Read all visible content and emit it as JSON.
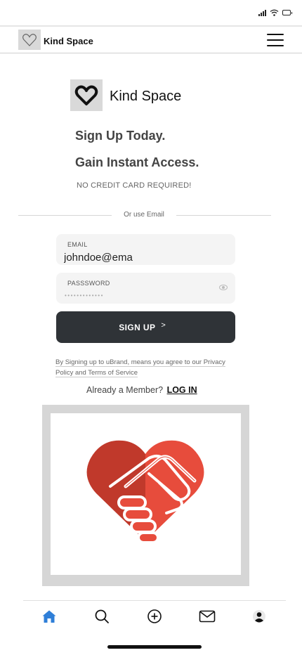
{
  "status_bar": {
    "signal_icon": "signal-icon",
    "wifi_icon": "wifi-icon",
    "battery_icon": "battery-icon"
  },
  "header": {
    "logo_icon": "heart-outline-icon",
    "title": "Kind Space",
    "menu_icon": "hamburger-menu-icon"
  },
  "brand": {
    "logo_icon": "heart-icon",
    "name": "Kind Space"
  },
  "hero": {
    "headline_1": "Sign Up Today.",
    "headline_2": "Gain Instant Access.",
    "subtext": "NO CREDIT CARD REQUIRED!"
  },
  "divider_text": "Or use Email",
  "form": {
    "email_label": "EMAIL",
    "email_value": "johndoe@ema",
    "password_label": "PASSSWORD",
    "password_dots": "•••••••••••••",
    "signup_label": "SIGN UP",
    "signup_chevron": ">"
  },
  "terms": {
    "text": "By Signing up to uBrand, means you agree to our Privacy Policy and Terms of Service"
  },
  "member": {
    "prompt": "Already a Member?",
    "login_label": "LOG IN"
  },
  "illustration": {
    "icon": "heart-handshake-icon"
  },
  "bottom_nav": {
    "items": [
      "home-icon",
      "search-icon",
      "add-circle-icon",
      "mail-icon",
      "profile-icon"
    ],
    "active": "home",
    "active_color": "#2f7fd8"
  },
  "colors": {
    "button_bg": "#2f3337",
    "heart_dark": "#c0392b",
    "heart_light": "#e74c3c"
  }
}
